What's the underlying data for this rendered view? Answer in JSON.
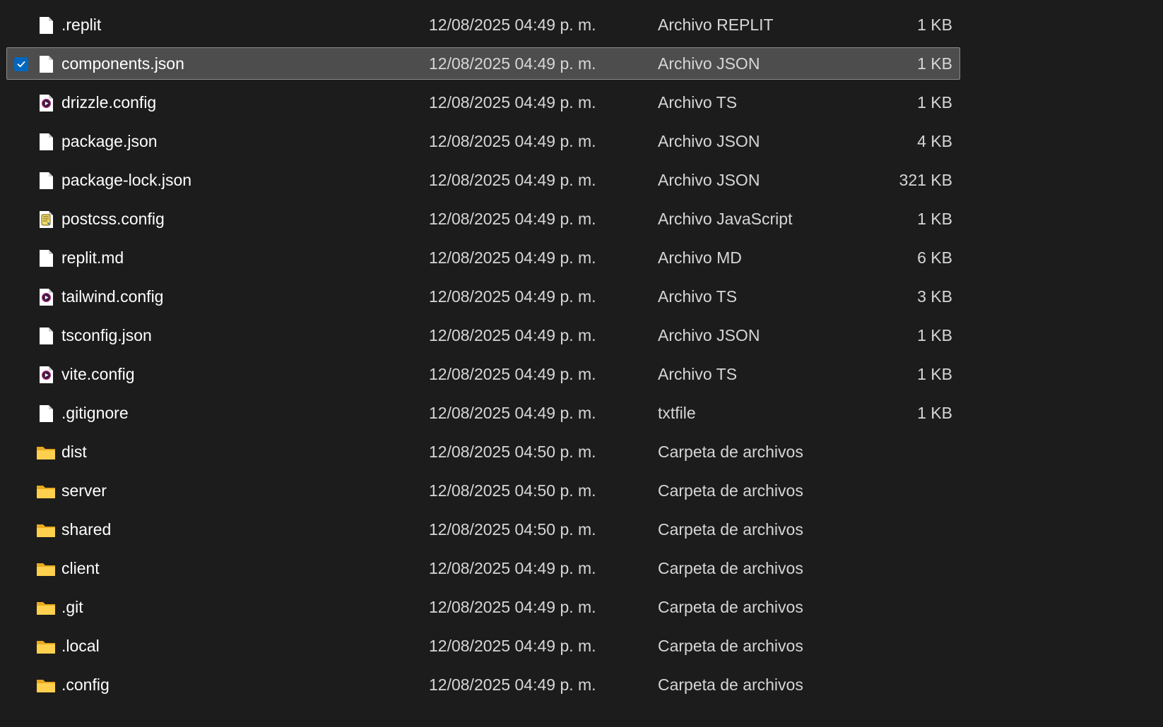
{
  "files": [
    {
      "name": ".replit",
      "date": "12/08/2025 04:49 p. m.",
      "type": "Archivo REPLIT",
      "size": "1 KB",
      "icon": "generic-file-icon",
      "selected": false
    },
    {
      "name": "components.json",
      "date": "12/08/2025 04:49 p. m.",
      "type": "Archivo JSON",
      "size": "1 KB",
      "icon": "generic-file-icon",
      "selected": true
    },
    {
      "name": "drizzle.config",
      "date": "12/08/2025 04:49 p. m.",
      "type": "Archivo TS",
      "size": "1 KB",
      "icon": "media-file-icon",
      "selected": false
    },
    {
      "name": "package.json",
      "date": "12/08/2025 04:49 p. m.",
      "type": "Archivo JSON",
      "size": "4 KB",
      "icon": "generic-file-icon",
      "selected": false
    },
    {
      "name": "package-lock.json",
      "date": "12/08/2025 04:49 p. m.",
      "type": "Archivo JSON",
      "size": "321 KB",
      "icon": "generic-file-icon",
      "selected": false
    },
    {
      "name": "postcss.config",
      "date": "12/08/2025 04:49 p. m.",
      "type": "Archivo JavaScript",
      "size": "1 KB",
      "icon": "script-file-icon",
      "selected": false
    },
    {
      "name": "replit.md",
      "date": "12/08/2025 04:49 p. m.",
      "type": "Archivo MD",
      "size": "6 KB",
      "icon": "generic-file-icon",
      "selected": false
    },
    {
      "name": "tailwind.config",
      "date": "12/08/2025 04:49 p. m.",
      "type": "Archivo TS",
      "size": "3 KB",
      "icon": "media-file-icon",
      "selected": false
    },
    {
      "name": "tsconfig.json",
      "date": "12/08/2025 04:49 p. m.",
      "type": "Archivo JSON",
      "size": "1 KB",
      "icon": "generic-file-icon",
      "selected": false
    },
    {
      "name": "vite.config",
      "date": "12/08/2025 04:49 p. m.",
      "type": "Archivo TS",
      "size": "1 KB",
      "icon": "media-file-icon",
      "selected": false
    },
    {
      "name": ".gitignore",
      "date": "12/08/2025 04:49 p. m.",
      "type": "txtfile",
      "size": "1 KB",
      "icon": "generic-file-icon",
      "selected": false
    },
    {
      "name": "dist",
      "date": "12/08/2025 04:50 p. m.",
      "type": "Carpeta de archivos",
      "size": "",
      "icon": "folder-icon",
      "selected": false
    },
    {
      "name": "server",
      "date": "12/08/2025 04:50 p. m.",
      "type": "Carpeta de archivos",
      "size": "",
      "icon": "folder-icon",
      "selected": false
    },
    {
      "name": "shared",
      "date": "12/08/2025 04:50 p. m.",
      "type": "Carpeta de archivos",
      "size": "",
      "icon": "folder-icon",
      "selected": false
    },
    {
      "name": "client",
      "date": "12/08/2025 04:49 p. m.",
      "type": "Carpeta de archivos",
      "size": "",
      "icon": "folder-icon",
      "selected": false
    },
    {
      "name": ".git",
      "date": "12/08/2025 04:49 p. m.",
      "type": "Carpeta de archivos",
      "size": "",
      "icon": "folder-icon",
      "selected": false
    },
    {
      "name": ".local",
      "date": "12/08/2025 04:49 p. m.",
      "type": "Carpeta de archivos",
      "size": "",
      "icon": "folder-icon",
      "selected": false
    },
    {
      "name": ".config",
      "date": "12/08/2025 04:49 p. m.",
      "type": "Carpeta de archivos",
      "size": "",
      "icon": "folder-icon",
      "selected": false
    }
  ],
  "colors": {
    "background": "#1c1c1c",
    "selection_background": "#4d4d4d",
    "selection_border": "#8a8a8a",
    "checkbox_accent": "#0067c0",
    "folder_yellow": "#ffd04d"
  }
}
